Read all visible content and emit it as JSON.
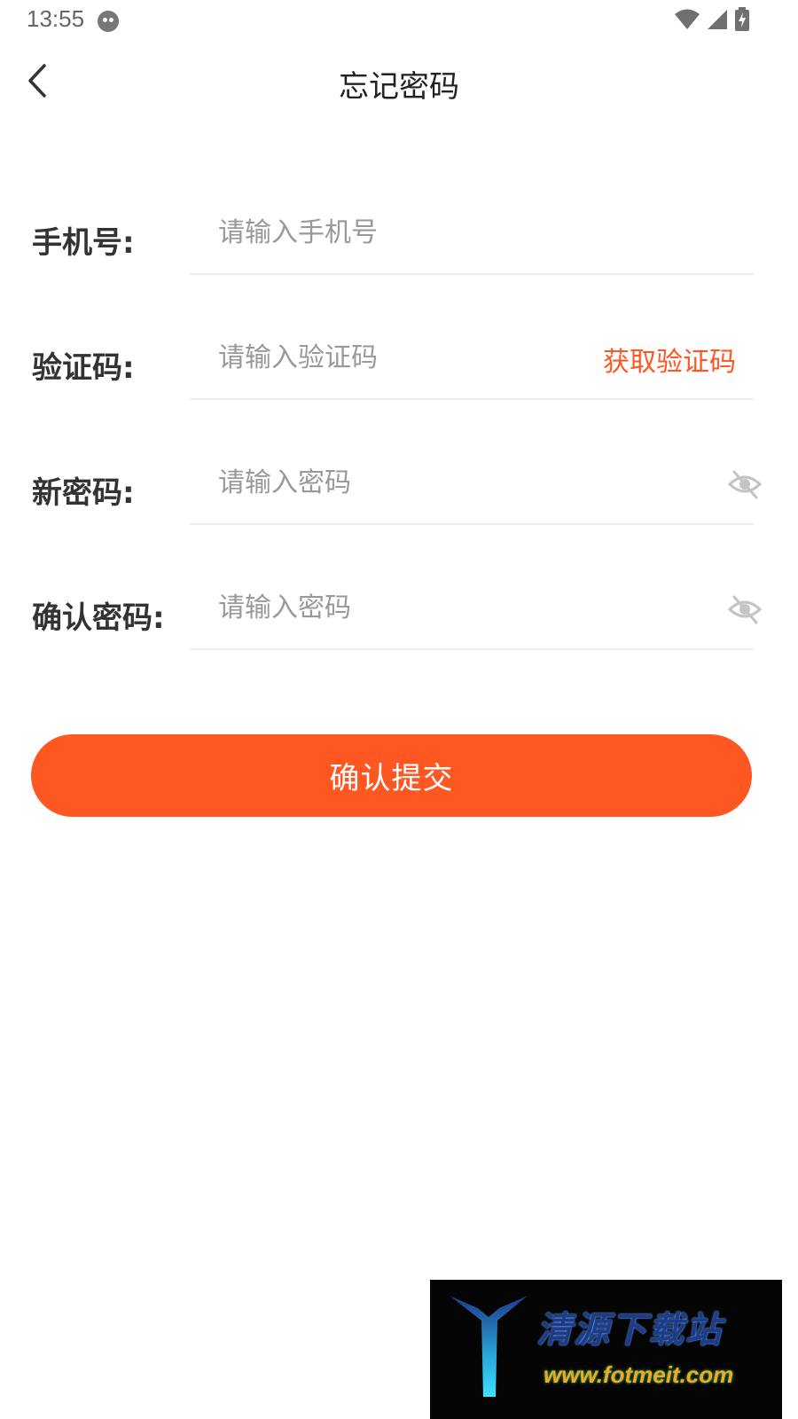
{
  "status_bar": {
    "time": "13:55",
    "icons": [
      "face-icon",
      "wifi-icon",
      "signal-icon",
      "battery-charging-icon"
    ]
  },
  "header": {
    "title": "忘记密码",
    "back_icon": "chevron-left-icon"
  },
  "form": {
    "phone": {
      "label": "手机号:",
      "placeholder": "请输入手机号"
    },
    "code": {
      "label": "验证码:",
      "placeholder": "请输入验证码",
      "get_code_label": "获取验证码"
    },
    "new_password": {
      "label": "新密码:",
      "placeholder": "请输入密码",
      "toggle_icon": "eye-off-icon"
    },
    "confirm_password": {
      "label": "确认密码:",
      "placeholder": "请输入密码",
      "toggle_icon": "eye-off-icon"
    }
  },
  "submit": {
    "label": "确认提交"
  },
  "watermark": {
    "title": "清源下载站",
    "url": "www.fotmeit.com"
  },
  "colors": {
    "accent": "#ff5722",
    "text": "#333333",
    "placeholder": "#999999",
    "divider": "#ececec"
  }
}
